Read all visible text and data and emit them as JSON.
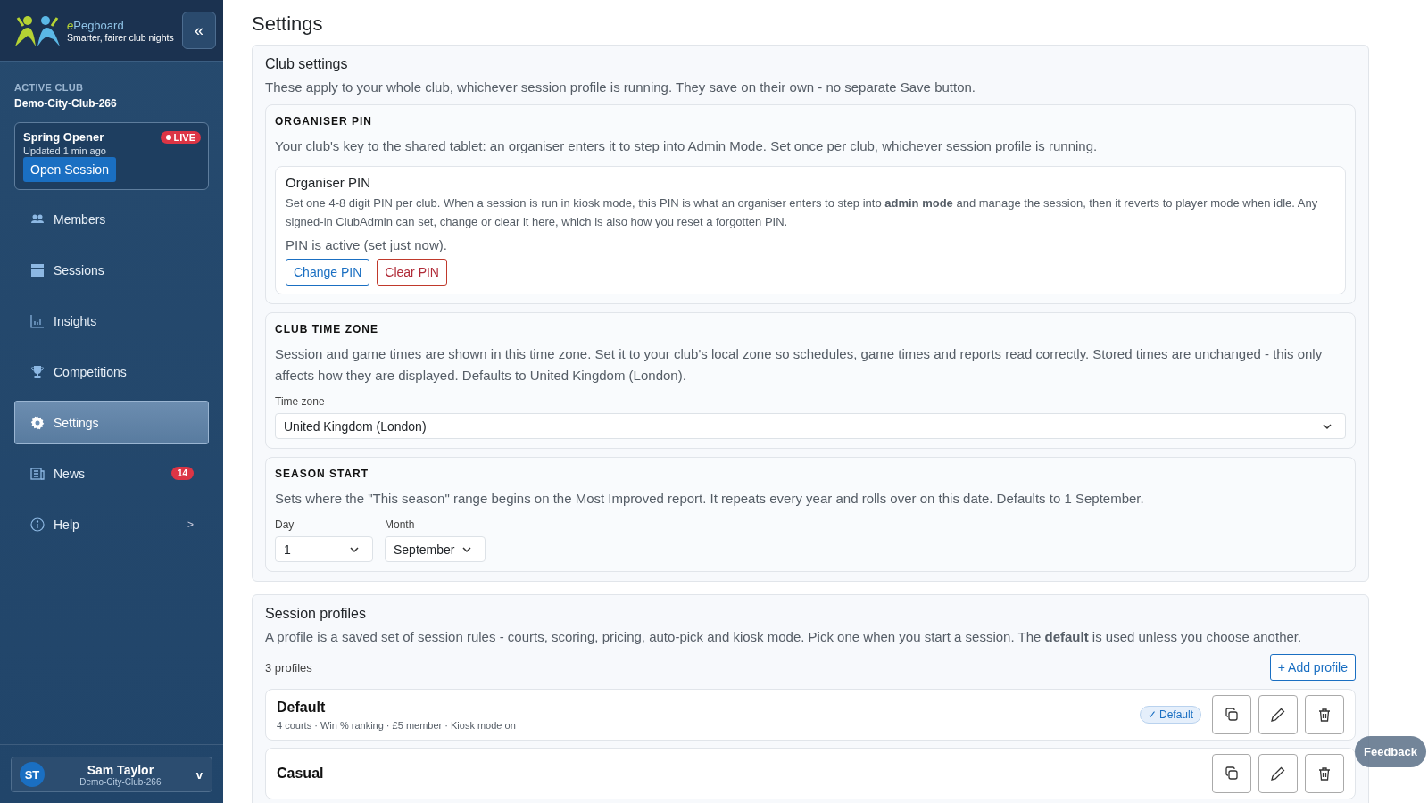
{
  "sidebar": {
    "brand": {
      "name_prefix": "e",
      "name_rest": "Pegboard",
      "tagline": "Smarter, fairer club nights"
    },
    "collapse_label": "«",
    "active_club": {
      "label": "ACTIVE CLUB",
      "name": "Demo-City-Club-266"
    },
    "live_session": {
      "name": "Spring Opener",
      "badge": "LIVE",
      "updated": "Updated 1 min ago",
      "button": "Open Session"
    },
    "items": [
      {
        "label": "Members",
        "selected": false
      },
      {
        "label": "Sessions",
        "selected": false
      },
      {
        "label": "Insights",
        "selected": false
      },
      {
        "label": "Competitions",
        "selected": false
      },
      {
        "label": "Settings",
        "selected": true
      },
      {
        "label": "News",
        "selected": false,
        "badge": "14"
      },
      {
        "label": "Help",
        "selected": false,
        "chevron": ">"
      }
    ],
    "user": {
      "initials": "ST",
      "name": "Sam Taylor",
      "club": "Demo-City-Club-266",
      "chevron": "v"
    }
  },
  "page_title": "Settings",
  "club_settings": {
    "title": "Club settings",
    "description": "These apply to your whole club, whichever session profile is running. They save on their own - no separate Save button.",
    "pin": {
      "heading": "ORGANISER PIN",
      "description": "Your club's key to the shared tablet: an organiser enters it to step into Admin Mode. Set once per club, whichever session profile is running.",
      "card_title": "Organiser PIN",
      "help": "Set one 4-8 digit PIN per club. When a session is run in kiosk mode, this PIN is what an organiser enters to step into **admin mode** and manage the session, then it reverts to player mode when idle. Any signed-in ClubAdmin can set, change or clear it here, which is also how you reset a forgotten PIN.",
      "status": "PIN is active (set just now).",
      "buttons": [
        {
          "label": "Change PIN",
          "kind": "primary"
        },
        {
          "label": "Clear PIN",
          "kind": "danger"
        }
      ]
    },
    "time_zone": {
      "heading": "CLUB TIME ZONE",
      "description": "Session and game times are shown in this time zone. Set it to your club's local zone so schedules, game times and reports read correctly. Stored times are unchanged - this only affects how they are displayed. Defaults to United Kingdom (London).",
      "field_label": "Time zone",
      "value": "United Kingdom (London)"
    },
    "season_start": {
      "heading": "SEASON START",
      "description": "Sets where the \"This season\" range begins on the Most Improved report. It repeats every year and rolls over on this date. Defaults to 1 September.",
      "day_label": "Day",
      "day": "1",
      "month_label": "Month",
      "month": "September"
    }
  },
  "session_profiles": {
    "title": "Session profiles",
    "description": "A profile is a saved set of session rules - courts, scoring, pricing, auto-pick and kiosk mode. Pick one when you start a session. The **default** is used unless you choose another.",
    "count": "3 profiles",
    "add_button": "+ Add profile",
    "profiles": [
      {
        "name": "Default",
        "meta": "4 courts · Win % ranking · £5 member · Kiosk mode on",
        "is_default": true,
        "default_badge": "✓ Default"
      },
      {
        "name": "Casual",
        "is_default": false
      }
    ]
  },
  "feedback_button": "Feedback"
}
